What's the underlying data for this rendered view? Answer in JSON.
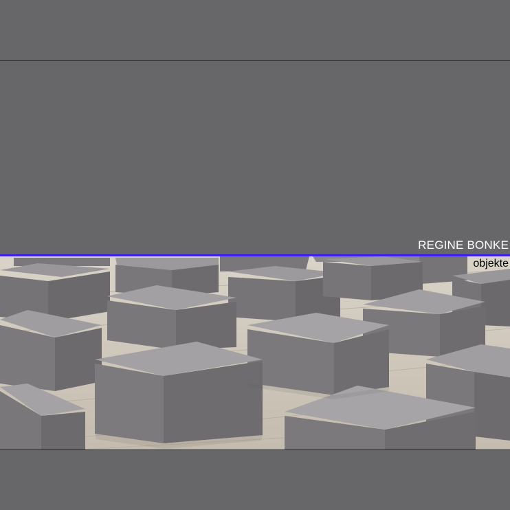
{
  "header": {
    "title": "REGINE BONKE"
  },
  "nav": {
    "current": "objekte"
  },
  "image": {
    "subject": "concrete-blocks-installation-photo"
  },
  "colors": {
    "background": "#676668",
    "accent": "#3a1ff0",
    "title_text": "#ffffff",
    "nav_text": "#000000"
  }
}
